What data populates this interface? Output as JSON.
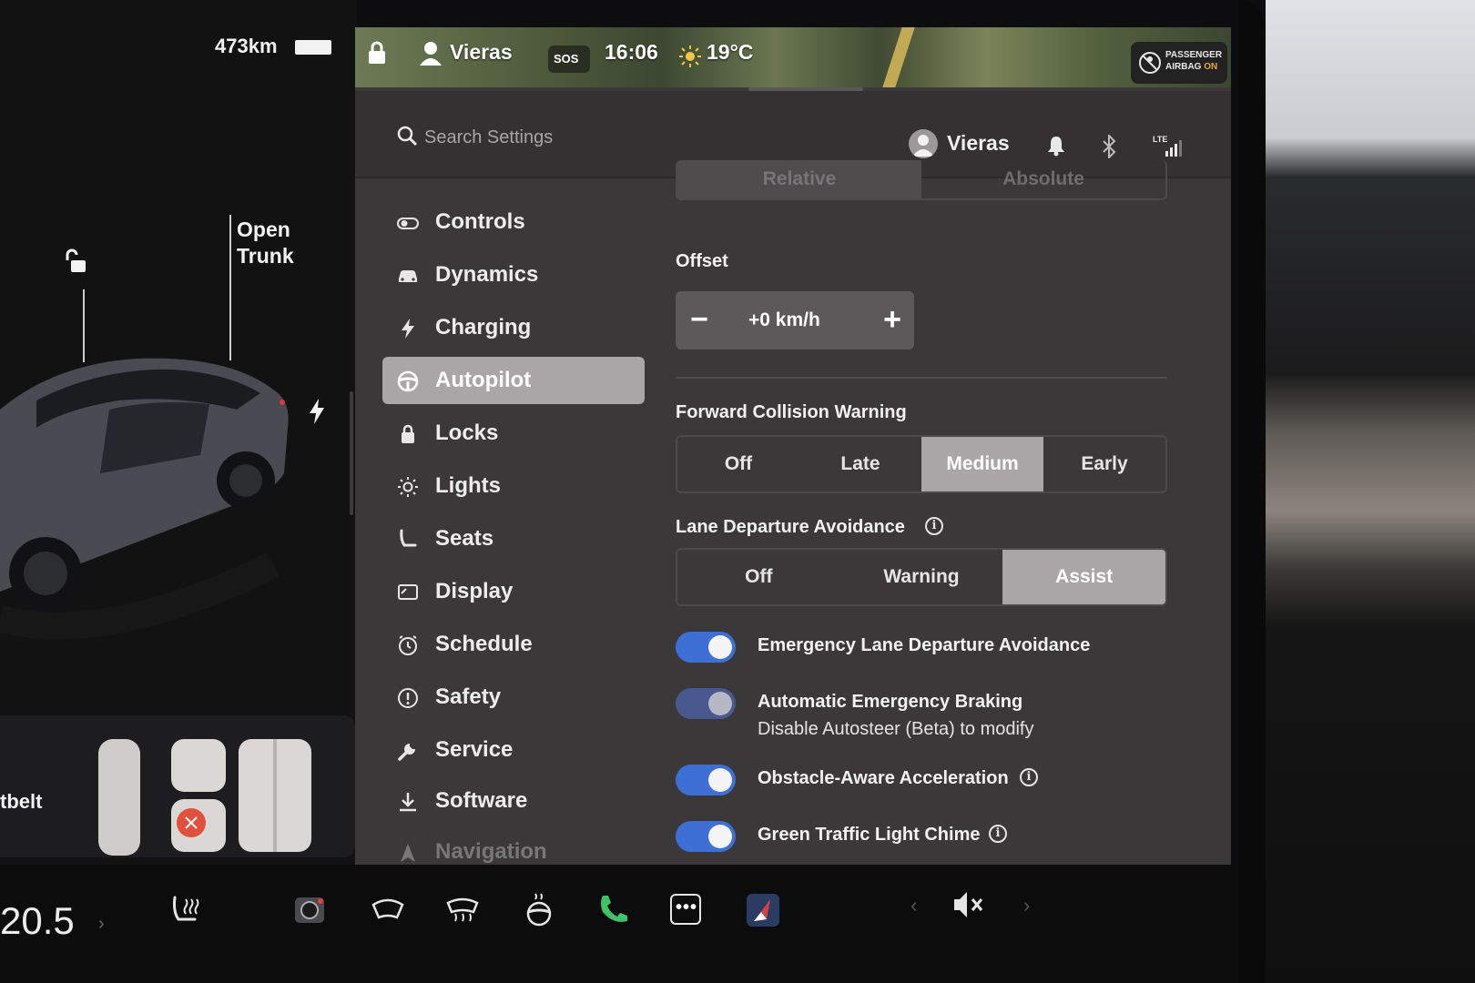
{
  "car": {
    "range": "473km",
    "open_trunk_label": "Open\nTrunk",
    "seatbelt_label": "tbelt",
    "cabin_temp": "20.5"
  },
  "status_bar": {
    "profile": "Vieras",
    "sos": "SOS",
    "time": "16:06",
    "temperature": "19°C",
    "airbag_line1": "PASSENGER",
    "airbag_line2": "AIRBAG",
    "airbag_state": "ON"
  },
  "header": {
    "search_placeholder": "Search Settings",
    "profile_name": "Vieras",
    "network": "LTE"
  },
  "sidebar": {
    "items": [
      {
        "label": "Controls",
        "icon": "toggle-icon"
      },
      {
        "label": "Dynamics",
        "icon": "car-icon"
      },
      {
        "label": "Charging",
        "icon": "bolt-icon"
      },
      {
        "label": "Autopilot",
        "icon": "steering-wheel-icon",
        "active": true
      },
      {
        "label": "Locks",
        "icon": "lock-icon"
      },
      {
        "label": "Lights",
        "icon": "sun-icon"
      },
      {
        "label": "Seats",
        "icon": "seat-icon"
      },
      {
        "label": "Display",
        "icon": "display-icon"
      },
      {
        "label": "Schedule",
        "icon": "clock-icon"
      },
      {
        "label": "Safety",
        "icon": "warning-icon"
      },
      {
        "label": "Service",
        "icon": "wrench-icon"
      },
      {
        "label": "Software",
        "icon": "download-icon"
      },
      {
        "label": "Navigation",
        "icon": "navigation-icon"
      }
    ]
  },
  "content": {
    "speed_mode": {
      "options": [
        "Relative",
        "Absolute"
      ],
      "selected": "Relative"
    },
    "offset": {
      "label": "Offset",
      "value": "+0 km/h",
      "minus": "−",
      "plus": "+"
    },
    "forward_collision": {
      "label": "Forward Collision Warning",
      "options": [
        "Off",
        "Late",
        "Medium",
        "Early"
      ],
      "selected": "Medium"
    },
    "lane_departure": {
      "label": "Lane Departure Avoidance",
      "options": [
        "Off",
        "Warning",
        "Assist"
      ],
      "selected": "Assist"
    },
    "toggles": [
      {
        "label": "Emergency Lane Departure Avoidance",
        "on": true
      },
      {
        "label": "Automatic Emergency Braking",
        "sub": "Disable Autosteer (Beta) to modify",
        "on": true,
        "disabled": true
      },
      {
        "label": "Obstacle-Aware Acceleration",
        "on": true,
        "info": true
      },
      {
        "label": "Green Traffic Light Chime",
        "on": true,
        "info": true
      }
    ]
  },
  "colors": {
    "toggle_on": "#3e6fd4",
    "selected_segment": "#aaa6a7",
    "panel": "#3a3839"
  },
  "taskbar": {
    "icons": [
      "seat-heater-icon",
      "dashcam-icon",
      "front-defrost-icon",
      "rear-defrost-icon",
      "steering-heater-icon",
      "phone-icon",
      "more-icon",
      "navigate-icon"
    ],
    "volume": "muted"
  }
}
